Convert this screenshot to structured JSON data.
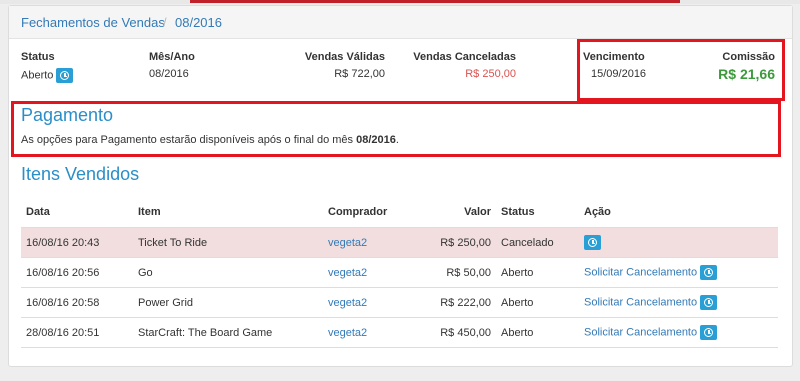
{
  "breadcrumb": {
    "items": [
      "Fechamentos de Vendas",
      "08/2016"
    ],
    "separator": "/"
  },
  "summary": {
    "status": {
      "label": "Status",
      "value": "Aberto"
    },
    "mes_ano": {
      "label": "Mês/Ano",
      "value": "08/2016"
    },
    "vendas_validas": {
      "label": "Vendas Válidas",
      "value": "R$ 722,00"
    },
    "vendas_canceladas": {
      "label": "Vendas Canceladas",
      "value": "R$ 250,00"
    },
    "vencimento": {
      "label": "Vencimento",
      "value": "15/09/2016"
    },
    "comissao": {
      "label": "Comissão",
      "value": "R$ 21,66"
    }
  },
  "pagamento": {
    "title": "Pagamento",
    "text_before": "As opções para Pagamento estarão disponíveis após o final do mês ",
    "month": "08/2016",
    "text_after": "."
  },
  "itens": {
    "title": "Itens Vendidos",
    "headers": [
      "Data",
      "Item",
      "Comprador",
      "Valor",
      "Status",
      "Ação"
    ],
    "rows": [
      {
        "data": "16/08/16 20:43",
        "item": "Ticket To Ride",
        "comprador": "vegeta2",
        "valor": "R$ 250,00",
        "status": "Cancelado",
        "acao": ""
      },
      {
        "data": "16/08/16 20:56",
        "item": "Go",
        "comprador": "vegeta2",
        "valor": "R$ 50,00",
        "status": "Aberto",
        "acao": "Solicitar Cancelamento"
      },
      {
        "data": "16/08/16 20:58",
        "item": "Power Grid",
        "comprador": "vegeta2",
        "valor": "R$ 222,00",
        "status": "Aberto",
        "acao": "Solicitar Cancelamento"
      },
      {
        "data": "28/08/16 20:51",
        "item": "StarCraft: The Board Game",
        "comprador": "vegeta2",
        "valor": "R$ 450,00",
        "status": "Aberto",
        "acao": "Solicitar Cancelamento"
      }
    ]
  },
  "colors": {
    "accent": "#2a9fd6",
    "highlight": "#e4151f",
    "cancel_row": "#f2dede",
    "comissao": "#3c9a3c",
    "canceled_value": "#d9534f"
  },
  "icons": {
    "status_button": "clock-icon",
    "row_action": "clock-icon"
  }
}
